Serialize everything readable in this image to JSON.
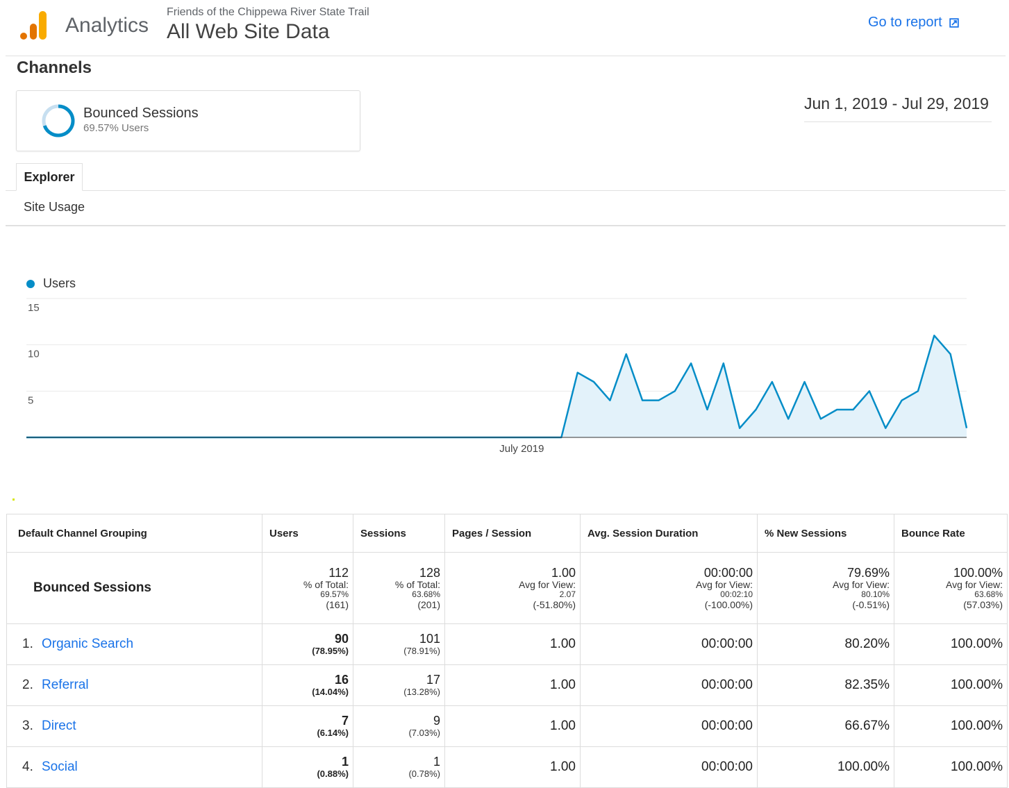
{
  "header": {
    "app_name": "Analytics",
    "account": "Friends of the Chippewa River State Trail",
    "property": "All Web Site Data",
    "goto_report": "Go to report"
  },
  "colors": {
    "accent": "#1a73e8",
    "series": "#058dc7",
    "logo_orange": "#f9ab00",
    "logo_dark_orange": "#e37400"
  },
  "report": {
    "title": "Channels",
    "date_range": "Jun 1, 2019 - Jul 29, 2019"
  },
  "segment": {
    "name": "Bounced Sessions",
    "share": "69.57% Users",
    "share_fraction": 0.6957
  },
  "tabs": {
    "explorer": "Explorer",
    "site_usage": "Site Usage"
  },
  "chart_data": {
    "type": "area",
    "series": [
      {
        "name": "Users",
        "values": [
          0,
          0,
          0,
          0,
          0,
          0,
          0,
          0,
          0,
          0,
          0,
          0,
          0,
          0,
          0,
          0,
          0,
          0,
          0,
          0,
          0,
          0,
          0,
          0,
          0,
          0,
          0,
          0,
          0,
          0,
          0,
          0,
          0,
          0,
          7,
          6,
          4,
          9,
          4,
          4,
          5,
          8,
          3,
          8,
          1,
          3,
          6,
          2,
          6,
          2,
          3,
          3,
          5,
          1,
          4,
          5,
          11,
          9,
          1
        ]
      }
    ],
    "x_start": "2019-06-01",
    "x_tick_label": "July 2019",
    "y_ticks": [
      5,
      10,
      15
    ],
    "ylim": [
      0,
      15
    ],
    "grid": true,
    "legend": "top-left"
  },
  "table": {
    "headers": [
      "Default Channel Grouping",
      "Users",
      "Sessions",
      "Pages / Session",
      "Avg. Session Duration",
      "% New Sessions",
      "Bounce Rate"
    ],
    "totals": {
      "label": "Bounced Sessions",
      "users": {
        "value": "112",
        "l1": "% of Total:",
        "l2": "69.57%",
        "l3": "(161)"
      },
      "sessions": {
        "value": "128",
        "l1": "% of Total:",
        "l2": "63.68%",
        "l3": "(201)"
      },
      "pages": {
        "value": "1.00",
        "l1": "Avg for View:",
        "l2": "2.07",
        "l3": "(-51.80%)"
      },
      "duration": {
        "value": "00:00:00",
        "l1": "Avg for View:",
        "l2": "00:02:10",
        "l3": "(-100.00%)"
      },
      "new_sessions": {
        "value": "79.69%",
        "l1": "Avg for View:",
        "l2": "80.10%",
        "l3": "(-0.51%)"
      },
      "bounce": {
        "value": "100.00%",
        "l1": "Avg for View:",
        "l2": "63.68%",
        "l3": "(57.03%)"
      }
    },
    "rows": [
      {
        "idx": "1.",
        "channel": "Organic Search",
        "users": "90",
        "users_pct": "(78.95%)",
        "sessions": "101",
        "sessions_pct": "(78.91%)",
        "pages": "1.00",
        "duration": "00:00:00",
        "new_sessions": "80.20%",
        "bounce": "100.00%"
      },
      {
        "idx": "2.",
        "channel": "Referral",
        "users": "16",
        "users_pct": "(14.04%)",
        "sessions": "17",
        "sessions_pct": "(13.28%)",
        "pages": "1.00",
        "duration": "00:00:00",
        "new_sessions": "82.35%",
        "bounce": "100.00%"
      },
      {
        "idx": "3.",
        "channel": "Direct",
        "users": "7",
        "users_pct": "(6.14%)",
        "sessions": "9",
        "sessions_pct": "(7.03%)",
        "pages": "1.00",
        "duration": "00:00:00",
        "new_sessions": "66.67%",
        "bounce": "100.00%"
      },
      {
        "idx": "4.",
        "channel": "Social",
        "users": "1",
        "users_pct": "(0.88%)",
        "sessions": "1",
        "sessions_pct": "(0.78%)",
        "pages": "1.00",
        "duration": "00:00:00",
        "new_sessions": "100.00%",
        "bounce": "100.00%"
      }
    ]
  }
}
